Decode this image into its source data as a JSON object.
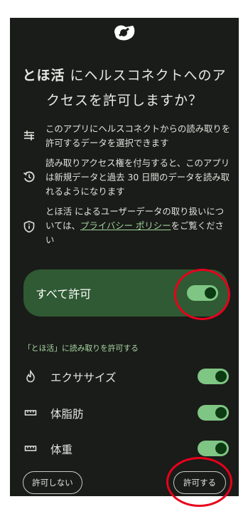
{
  "dialog": {
    "title_app": "とほ活",
    "title_line1_rest": "にヘルスコネクトへのア",
    "title_line2": "クセスを許可しますか？"
  },
  "info": {
    "select_data": "このアプリにヘルスコネクトからの読み取りを許可するデータを選択できます",
    "history": "読み取りアクセス権を付与すると、このアプリは新規データと過去 30 日間のデータを読み取れるようになります",
    "privacy_prefix": "とほ活 によるユーザーデータの取り扱いについては、",
    "privacy_link": "プライバシー ポリシー",
    "privacy_suffix": "をご覧ください"
  },
  "allow_all": {
    "label": "すべて許可",
    "on": true
  },
  "section_label": "「とほ活」に読み取りを許可する",
  "permissions": [
    {
      "label": "エクササイズ",
      "icon": "fire-icon",
      "on": true
    },
    {
      "label": "体脂肪",
      "icon": "ruler-icon",
      "on": true
    },
    {
      "label": "体重",
      "icon": "ruler-icon",
      "on": true
    }
  ],
  "buttons": {
    "deny": "許可しない",
    "allow": "許可する"
  },
  "colors": {
    "background": "#1a1c19",
    "allow_all_bg": "#2f5a33",
    "toggle_on": "#7fc584",
    "accent_text": "#a8d9a3",
    "annotation": "#e8001c"
  }
}
